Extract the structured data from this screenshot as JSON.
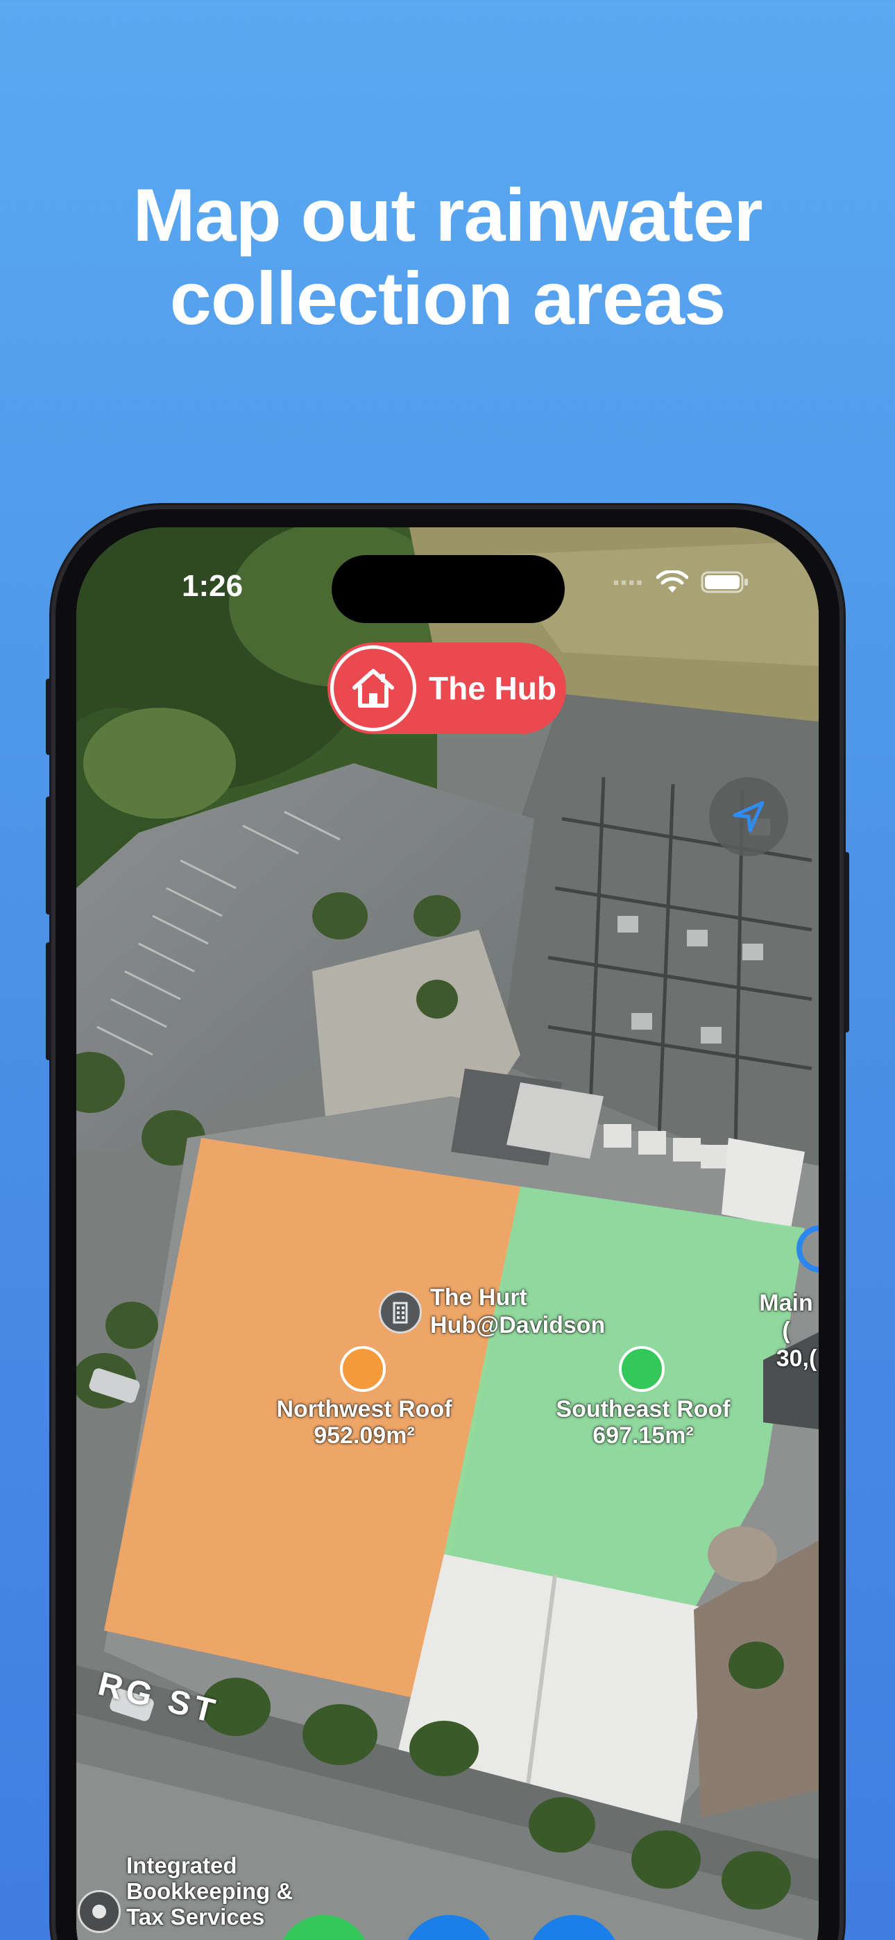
{
  "headline": {
    "line1": "Map out rainwater",
    "line2": "collection areas"
  },
  "status_bar": {
    "time": "1:26",
    "signal_icon": "cellular-dots-icon",
    "wifi_icon": "wifi-icon",
    "battery_icon": "battery-icon"
  },
  "hub_pill": {
    "label": "The Hub",
    "icon": "house-icon",
    "color": "#ea4a4f"
  },
  "locate_button": {
    "icon": "location-arrow-icon"
  },
  "poi": {
    "building": {
      "line1": "The Hurt",
      "line2": "Hub@Davidson",
      "icon": "building-icon"
    },
    "edge_label": {
      "line1": "Main (",
      "line2": "30,("
    },
    "bookkeeping": {
      "line1": "Integrated",
      "line2": "Bookkeeping &",
      "line3": "Tax Services",
      "icon": "pin-icon"
    }
  },
  "roofs": [
    {
      "name": "Northwest Roof",
      "area": "952.09m²",
      "color": "#f6a865"
    },
    {
      "name": "Southeast Roof",
      "area": "697.15m²",
      "color": "#34c759"
    }
  ],
  "street": {
    "label": "RG ST"
  },
  "tab_bar": [
    {
      "icon": "map-icon",
      "color": "#34c759"
    },
    {
      "icon": "polygon-select-icon",
      "color": "#1a7fe8"
    },
    {
      "icon": "water-drop-icon",
      "color": "#1a7fe8"
    }
  ]
}
